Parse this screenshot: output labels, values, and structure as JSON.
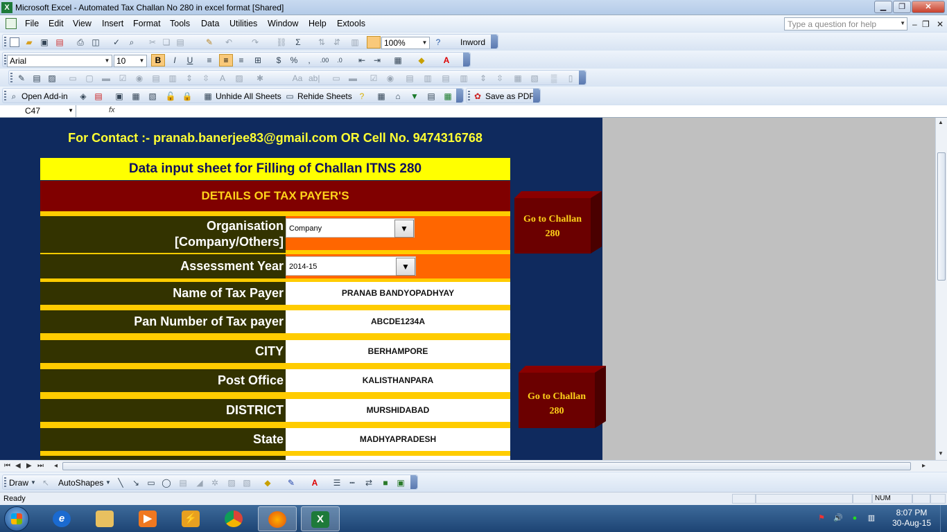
{
  "window": {
    "title": "Microsoft Excel - Automated Tax Challan No 280 in excel format  [Shared]",
    "controls": [
      "minimize",
      "restore",
      "close"
    ]
  },
  "menu": {
    "items": [
      "File",
      "Edit",
      "View",
      "Insert",
      "Format",
      "Tools",
      "Data",
      "Utilities",
      "Window",
      "Help",
      "Extools"
    ],
    "help_placeholder": "Type a question for help"
  },
  "toolbar": {
    "zoom": "100%",
    "inword_label": "Inword",
    "font_name": "Arial",
    "font_size": "10",
    "open_addin_label": "Open Add-in",
    "unhide_label": "Unhide All Sheets",
    "rehide_label": "Rehide Sheets",
    "save_pdf_label": "Save as PDF"
  },
  "formula_bar": {
    "cell_ref": "C47",
    "fx": "fx",
    "content": ""
  },
  "sheet": {
    "contact": "For Contact :- pranab.banerjee83@gmail.com OR Cell No. 9474316768",
    "input_header": "Data input sheet for Filling of Challan ITNS 280",
    "details_header": "DETAILS OF TAX PAYER'S",
    "organisation": {
      "label_line1": "Organisation",
      "label_line2": "[Company/Others]",
      "value": "Company"
    },
    "assessment_year": {
      "label": "Assessment Year",
      "value": "2014-15"
    },
    "rows": [
      {
        "label": "Name of Tax Payer",
        "value": "PRANAB BANDYOPADHYAY"
      },
      {
        "label": "Pan Number of Tax payer",
        "value": "ABCDE1234A"
      },
      {
        "label": "CITY",
        "value": "BERHAMPORE"
      },
      {
        "label": "Post Office",
        "value": "KALISTHANPARA"
      },
      {
        "label": "DISTRICT",
        "value": "MURSHIDABAD"
      },
      {
        "label": "State",
        "value": "MADHYAPRADESH"
      }
    ],
    "goto_button_1": {
      "line1": "Go to Challan",
      "line2": "280"
    },
    "goto_button_2": {
      "line1": "Go to Challan",
      "line2": "280"
    }
  },
  "drawing_toolbar": {
    "draw_label": "Draw",
    "autoshapes_label": "AutoShapes"
  },
  "status": {
    "ready": "Ready",
    "num": "NUM"
  },
  "taskbar": {
    "apps": [
      "internet-explorer",
      "file-explorer",
      "media-player",
      "winamp",
      "chrome",
      "firefox",
      "excel"
    ],
    "time": "8:07 PM",
    "date": "30-Aug-15"
  }
}
